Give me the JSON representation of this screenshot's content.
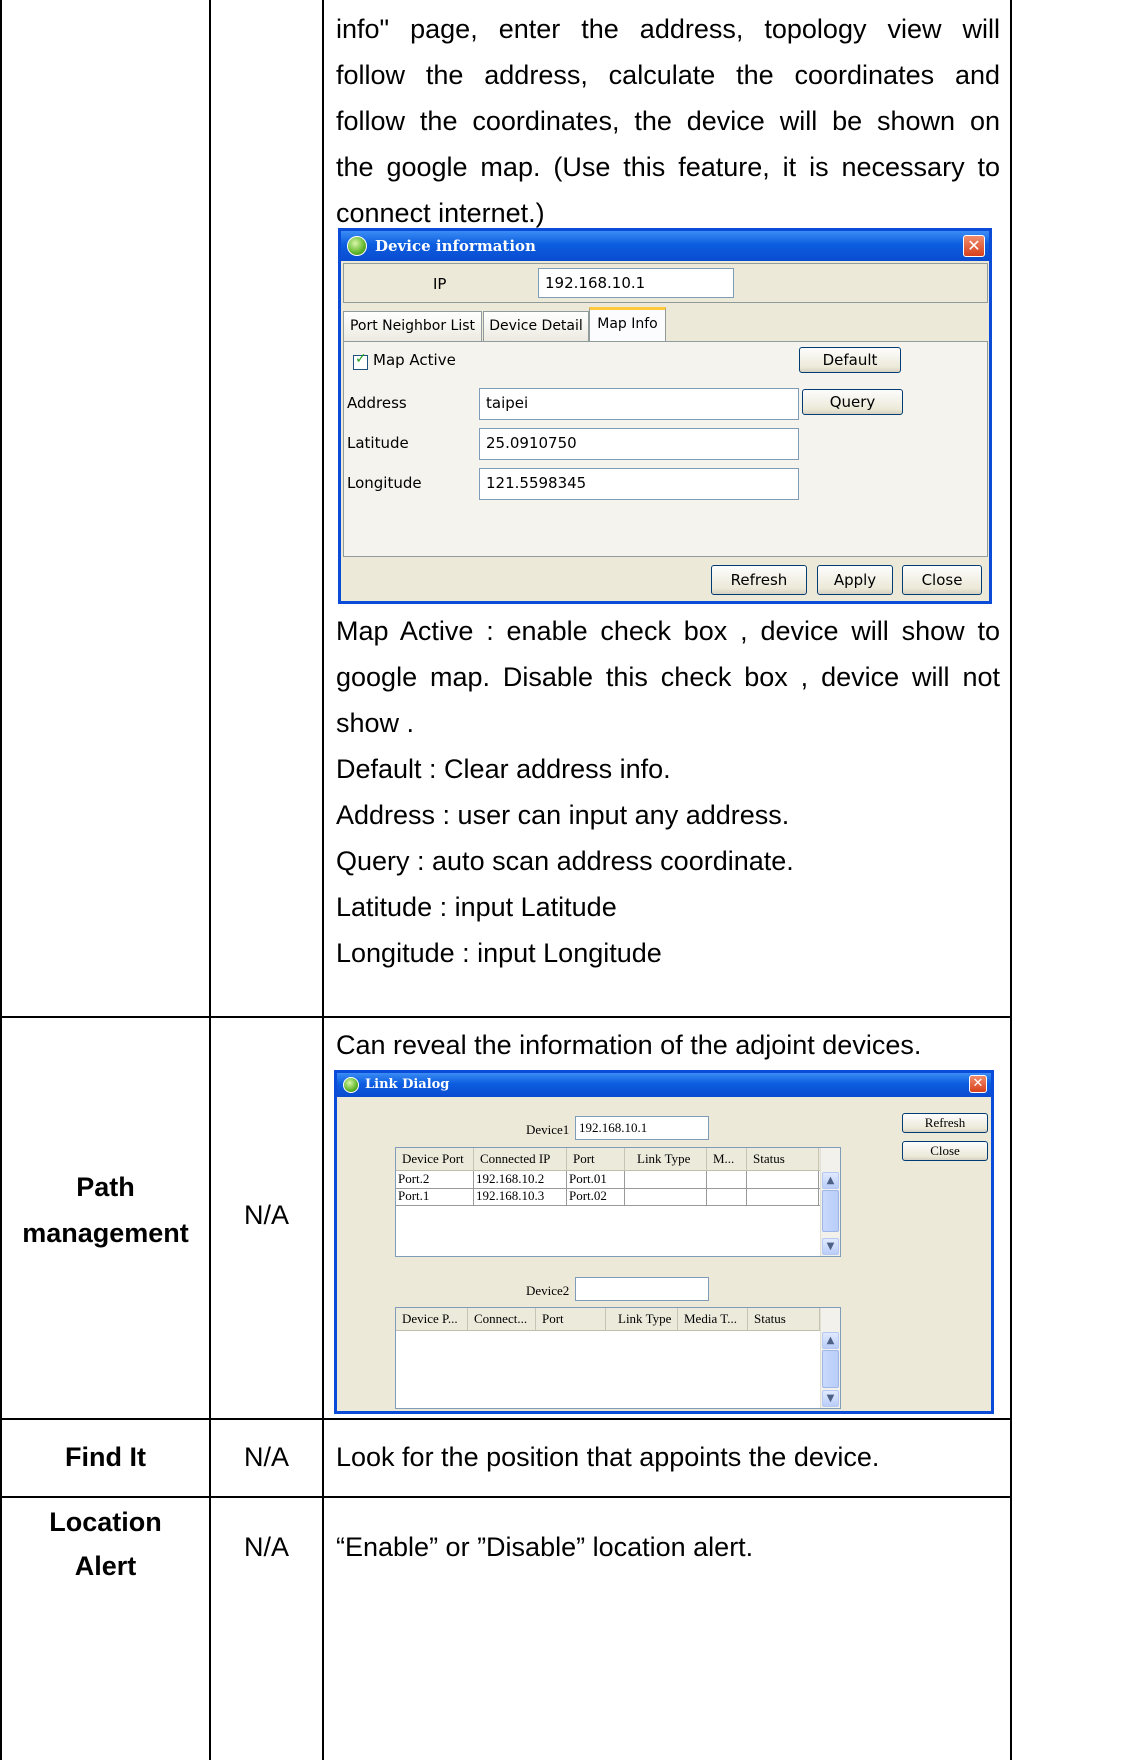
{
  "row_map": {
    "description_lines": [
      "info\" page, enter the address, topology view will",
      "follow the address, calculate the coordinates and",
      "follow the coordinates, the device will be shown on",
      "the google map. (Use this feature, it is necessary to",
      "connect internet.)"
    ],
    "dialog": {
      "title": "Device information",
      "ip_label": "IP",
      "ip_value": "192.168.10.1",
      "tabs": [
        "Port Neighbor List",
        "Device Detail",
        "Map Info"
      ],
      "map_active_label": "Map Active",
      "map_active_checked": true,
      "default_button": "Default",
      "address_label": "Address",
      "address_value": "taipei",
      "query_button": "Query",
      "latitude_label": "Latitude",
      "latitude_value": "25.0910750",
      "longitude_label": "Longitude",
      "longitude_value": "121.5598345",
      "refresh_button": "Refresh",
      "apply_button": "Apply",
      "close_button": "Close"
    },
    "notes": [
      "Map Active : enable check box , device will show to",
      "google map. Disable this check box , device will not",
      "show .",
      "Default : Clear address info.",
      "Address : user can input any address.",
      "Query : auto scan address coordinate.",
      "Latitude : input Latitude",
      "Longitude : input Longitude"
    ]
  },
  "row_path": {
    "name_line1": "Path",
    "name_line2": "management",
    "value": "N/A",
    "description": "Can reveal the information of the adjoint devices.",
    "dialog": {
      "title": "Link Dialog",
      "device1_label": "Device1",
      "device1_value": "192.168.10.1",
      "device2_label": "Device2",
      "device2_value": "",
      "refresh_button": "Refresh",
      "close_button": "Close",
      "table1_headers": [
        "Device Port",
        "Connected IP",
        "Port",
        "Link Type",
        "M...",
        "Status"
      ],
      "table1_rows": [
        [
          "Port.2",
          "192.168.10.2",
          "Port.01",
          "",
          "",
          ""
        ],
        [
          "Port.1",
          "192.168.10.3",
          "Port.02",
          "",
          "",
          ""
        ]
      ],
      "table2_headers": [
        "Device P...",
        "Connect...",
        "Port",
        "Link Type",
        "Media T...",
        "Status"
      ]
    }
  },
  "row_find": {
    "name": "Find It",
    "value": "N/A",
    "description": "Look for the position that appoints the device."
  },
  "row_location": {
    "name_line1": "Location",
    "name_line2": "Alert",
    "value": "N/A",
    "description": "“Enable” or ”Disable” location alert."
  }
}
